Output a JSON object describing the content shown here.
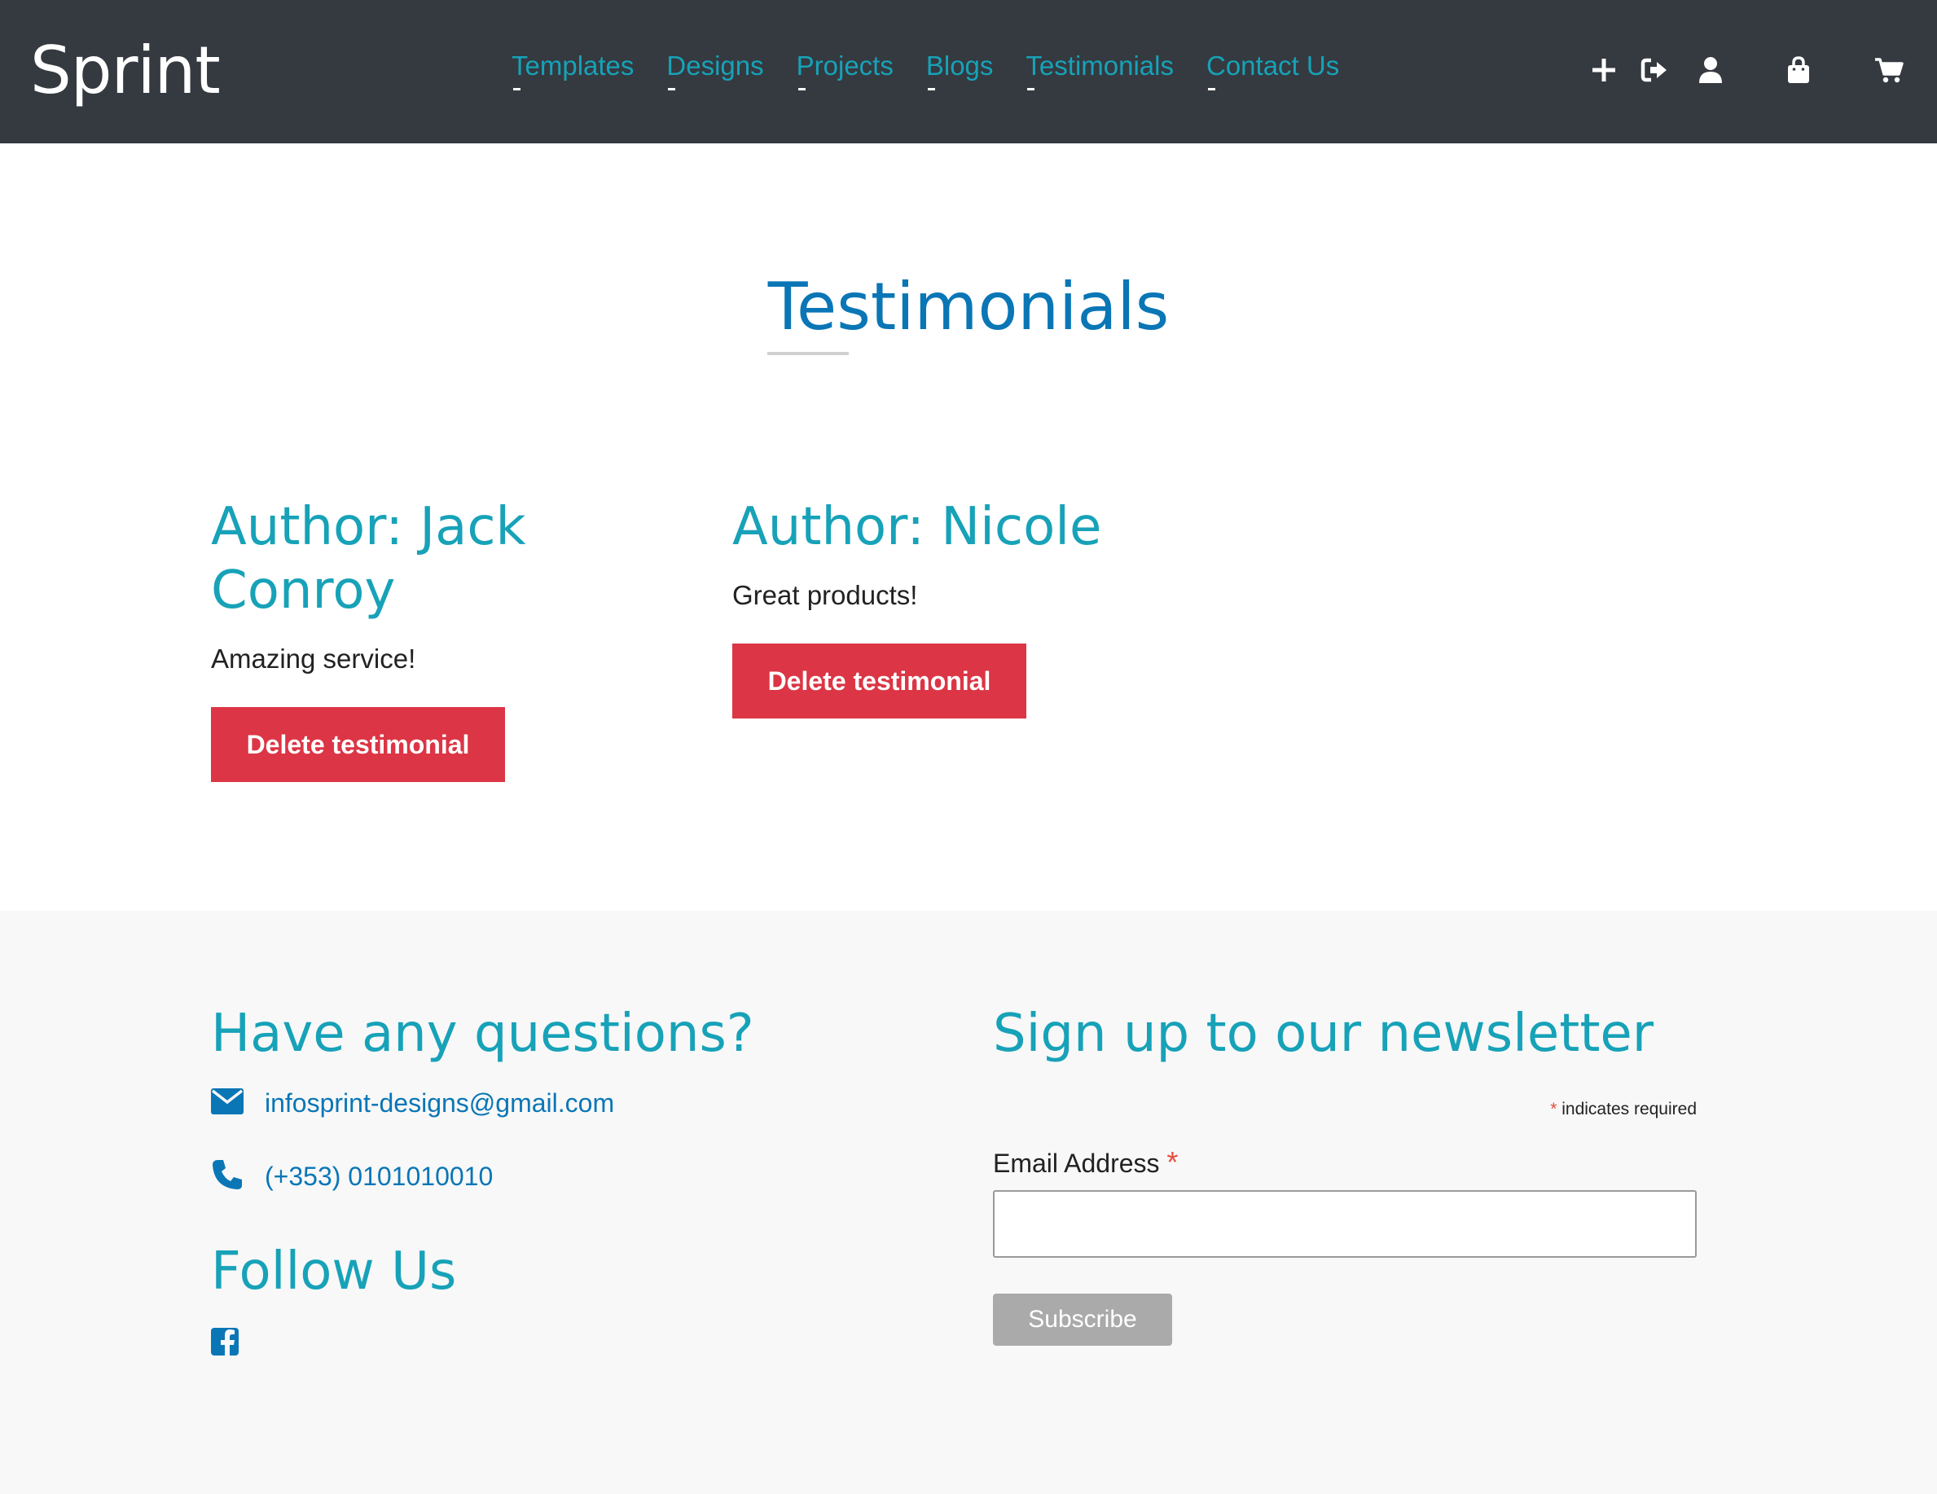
{
  "nav": {
    "brand": "Sprint",
    "links": [
      "Templates",
      "Designs",
      "Projects",
      "Blogs",
      "Testimonials",
      "Contact Us"
    ],
    "icons": [
      "plus-icon",
      "sign-out-icon",
      "user-icon",
      "shopping-bag-icon",
      "shopping-cart-icon"
    ]
  },
  "main": {
    "title": "Testimonials",
    "testimonials": [
      {
        "author": "Author: Jack Conroy",
        "text": "Amazing service!",
        "button": "Delete testimonial"
      },
      {
        "author": "Author: Nicole",
        "text": "Great products!",
        "button": "Delete testimonial"
      }
    ]
  },
  "footer": {
    "questions_heading": "Have any questions?",
    "email": "infosprint-designs@gmail.com",
    "phone": "(+353) 0101010010",
    "follow_heading": "Follow Us",
    "newsletter_heading": "Sign up to our newsletter",
    "required_star": "*",
    "required_note": "indicates required",
    "email_label": "Email Address",
    "email_value": "",
    "subscribe_label": "Subscribe"
  },
  "colors": {
    "navbar_bg": "#343a40",
    "accent": "#17a2b8",
    "title": "#0a76b6",
    "danger": "#dc3545",
    "footer_bg": "#f8f8f8",
    "subscribe_bg": "#aaaaaa"
  }
}
